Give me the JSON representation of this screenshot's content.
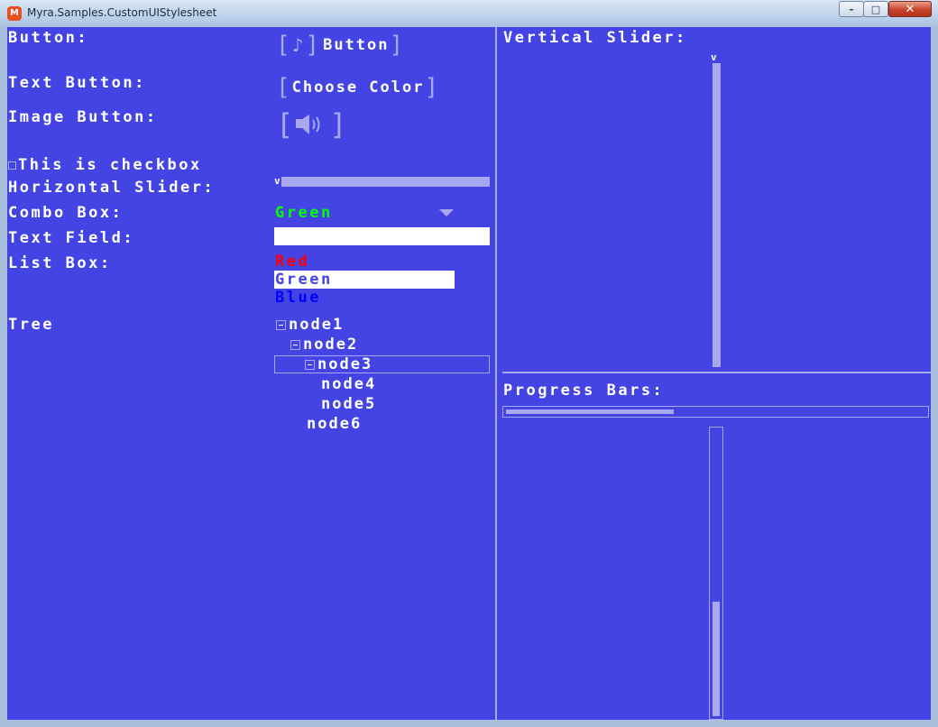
{
  "window": {
    "title": "Myra.Samples.CustomUIStylesheet",
    "icon": "monogame-icon",
    "controls": [
      "–",
      "□",
      "✕"
    ]
  },
  "colors": {
    "background": "#4444e4",
    "accent": "#a8a8f0",
    "text": "#ffffff",
    "red": "#ff0000",
    "green": "#00ff00",
    "blue": "#0000ff"
  },
  "left": {
    "button_label": "Button:",
    "button_text": "Button",
    "button_icon": "music-note-icon",
    "text_button_label": "Text Button:",
    "text_button_text": "Choose Color",
    "image_button_label": "Image Button:",
    "image_button_icon": "speaker-icon",
    "checkbox_label": "This is checkbox",
    "checkbox_checked": false,
    "hslider_label": "Horizontal Slider:",
    "hslider_value": 0,
    "combo_label": "Combo Box:",
    "combo_value": "Green",
    "textfield_label": "Text Field:",
    "textfield_value": "",
    "listbox_label": "List Box:",
    "listbox_items": [
      "Red",
      "Green",
      "Blue"
    ],
    "listbox_selected": "Green",
    "tree_label": "Tree",
    "tree_nodes": [
      "node1",
      "node2",
      "node3",
      "node4",
      "node5",
      "node6"
    ],
    "tree_selected": "node3"
  },
  "right": {
    "vslider_label": "Vertical Slider:",
    "vslider_value": 0,
    "progress_label": "Progress Bars:",
    "hprogress_value": 0.4,
    "vprogress_value": 0.4
  }
}
